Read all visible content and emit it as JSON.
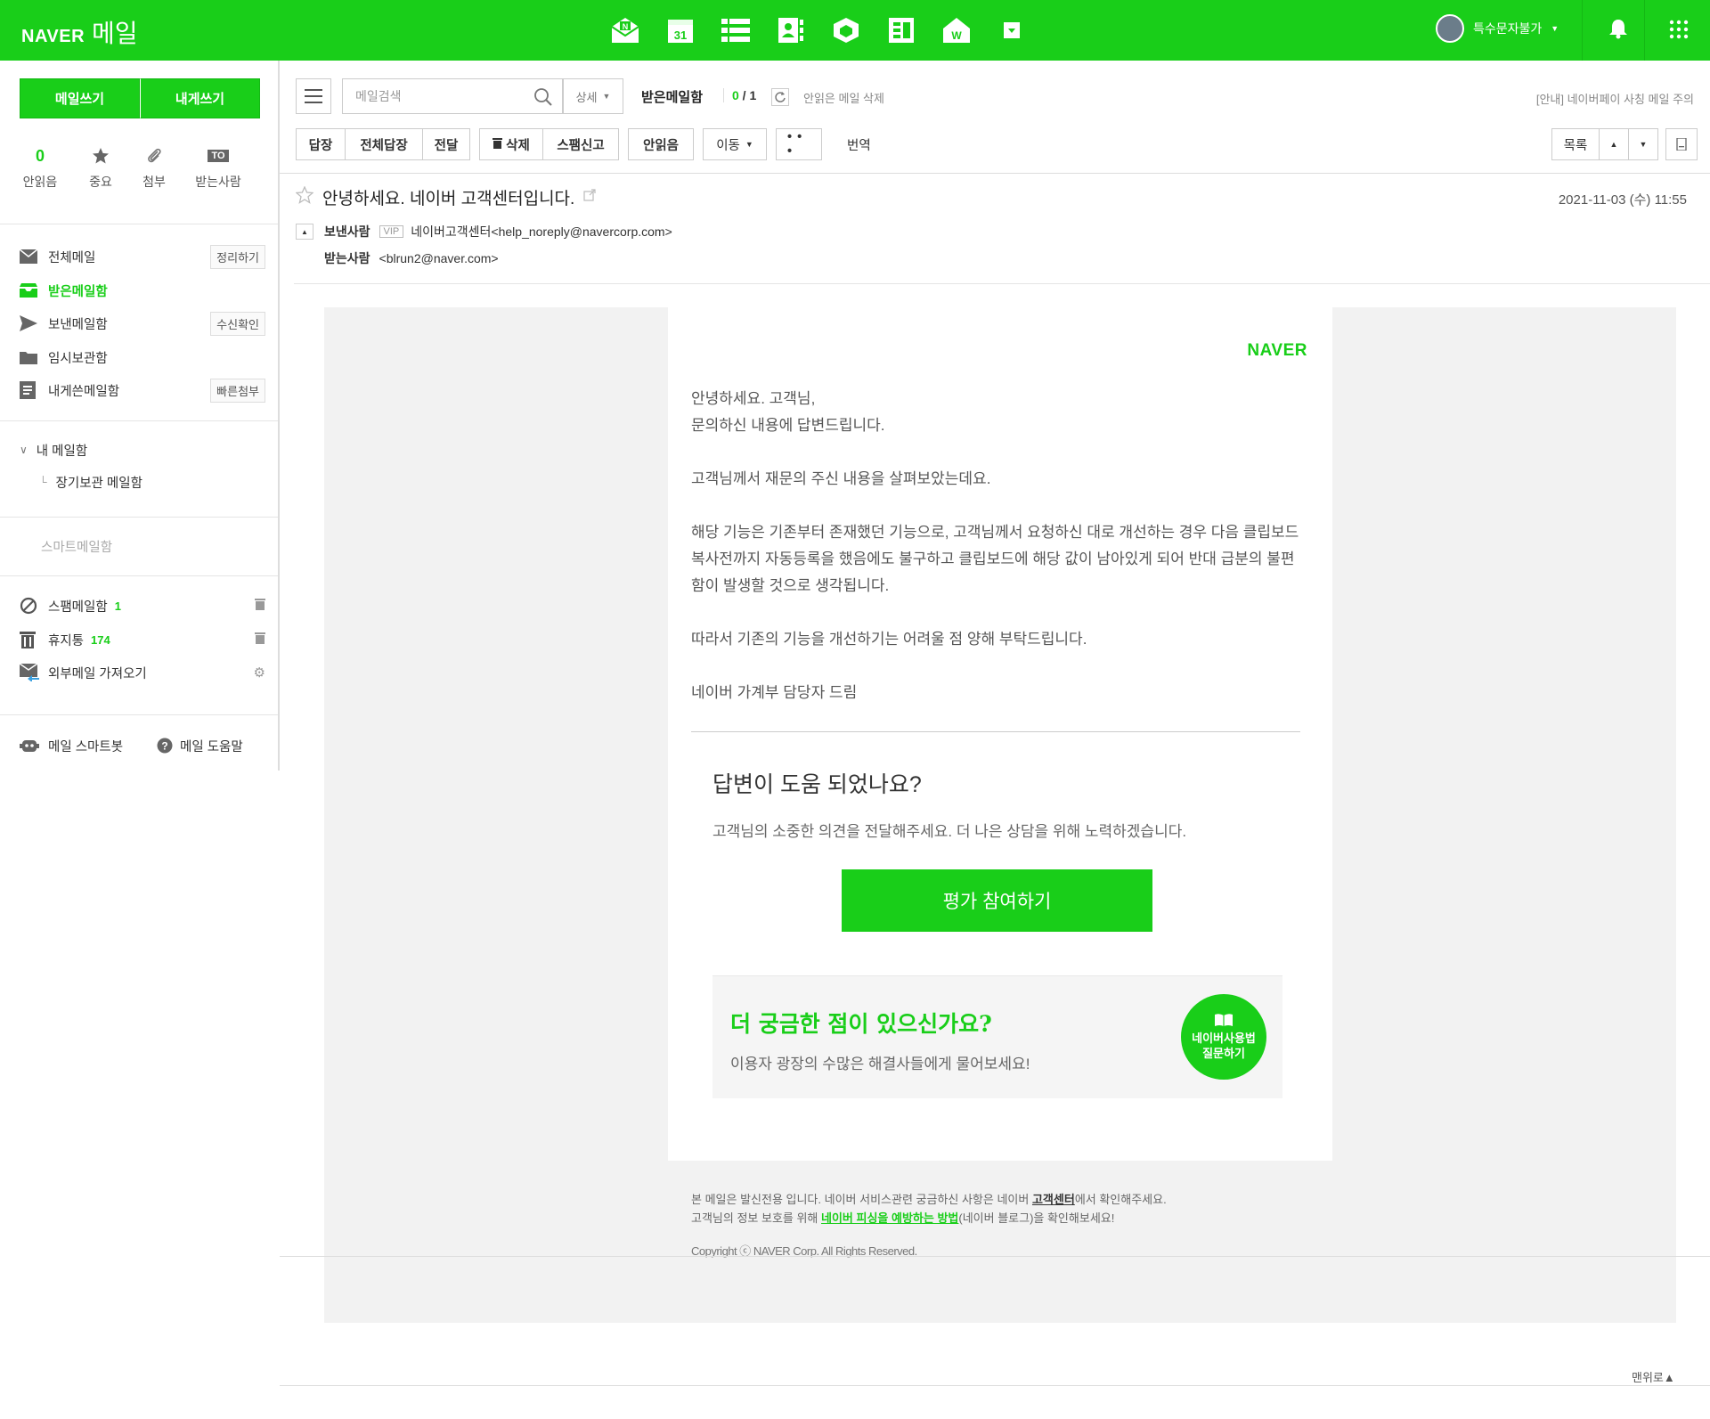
{
  "topbar": {
    "brand": "NAVER",
    "service": "메일",
    "user_name": "특수문자불가",
    "app_icons": [
      "mail-icon",
      "calendar-icon",
      "list-icon",
      "contacts-icon",
      "cube-icon",
      "board-icon",
      "home-work-icon",
      "more-apps-icon"
    ],
    "brand_color": "#19ce19"
  },
  "sidebar": {
    "write_mail": "메일쓰기",
    "write_self": "내게쓰기",
    "quick": [
      {
        "top": "0",
        "label": "안읽음"
      },
      {
        "top": "",
        "label": "중요"
      },
      {
        "top": "",
        "label": "첨부"
      },
      {
        "top": "TO",
        "label": "받는사람"
      }
    ],
    "folders": [
      {
        "label": "전체메일",
        "tag": "정리하기"
      },
      {
        "label": "받은메일함",
        "tag": ""
      },
      {
        "label": "보낸메일함",
        "tag": "수신확인"
      },
      {
        "label": "임시보관함",
        "tag": ""
      },
      {
        "label": "내게쓴메일함",
        "tag": "빠른첨부"
      }
    ],
    "my_mailbox": "내 메일함",
    "archive": "장기보관 메일함",
    "smart_mailbox": "스마트메일함",
    "spam": {
      "label": "스팸메일함",
      "count": "1"
    },
    "trash": {
      "label": "휴지통",
      "count": "174"
    },
    "external": "외부메일 가져오기",
    "smartbot": "메일 스마트봇",
    "help": "메일 도움말"
  },
  "toolbar": {
    "search_placeholder": "메일검색",
    "detail": "상세",
    "mailbox_title": "받은메일함",
    "unread": "0",
    "total": "1",
    "delete_unread": "안읽은 메일 삭제",
    "notice": "[안내] 네이버페이 사칭 메일 주의",
    "reply": "답장",
    "reply_all": "전체답장",
    "forward": "전달",
    "delete": "삭제",
    "report_spam": "스팸신고",
    "mark_unread": "안읽음",
    "move": "이동",
    "more": "• • •",
    "translate": "번역",
    "list": "목록"
  },
  "message": {
    "subject": "안녕하세요. 네이버 고객센터입니다.",
    "date": "2021-11-03 (수) 11:55",
    "sender_label": "보낸사람",
    "vip": "VIP",
    "sender": "네이버고객센터<help_noreply@navercorp.com>",
    "recipient_label": "받는사람",
    "recipient": "<blrun2@naver.com>"
  },
  "body": {
    "logo": "NAVER",
    "p1a": "안녕하세요. 고객님,",
    "p1b": "문의하신 내용에 답변드립니다.",
    "p2": "고객님께서 재문의 주신 내용을 살펴보았는데요.",
    "p3": "해당 기능은 기존부터 존재했던 기능으로, 고객님께서 요청하신 대로 개선하는 경우 다음 클립보드 복사전까지 자동등록을 했음에도 불구하고 클립보드에 해당 값이 남아있게 되어 반대 급분의 불편함이 발생할 것으로 생각됩니다.",
    "p4": "따라서 기존의 기능을 개선하기는 어려울 점 양해 부탁드립니다.",
    "p5": "네이버 가계부 담당자 드림",
    "help_question": "답변이 도움 되었나요?",
    "help_sub": "고객님의 소중한 의견을 전달해주세요. 더 나은 상담을 위해 노력하겠습니다.",
    "rate_button": "평가 참여하기",
    "faq_question": "더 궁금한 점이 있으신가요?",
    "faq_sub": "이용자 광장의 수많은 해결사들에게 물어보세요!",
    "faq_circle_1": "네이버사용법",
    "faq_circle_2": "질문하기"
  },
  "footer": {
    "line1a": "본 메일은 발신전용 입니다. 네이버 서비스관련 궁금하신 사항은 네이버 ",
    "line1b": "고객센터",
    "line1c": "에서 확인해주세요.",
    "line2a": "고객님의 정보 보호를 위해 ",
    "line2b": "네이버 피싱을 예방하는 방법",
    "line2c": "(네이버 블로그)을 확인해보세요!",
    "copyright": "Copyright ⓒ NAVER Corp. All Rights Reserved.",
    "to_top": "맨위로▲"
  }
}
